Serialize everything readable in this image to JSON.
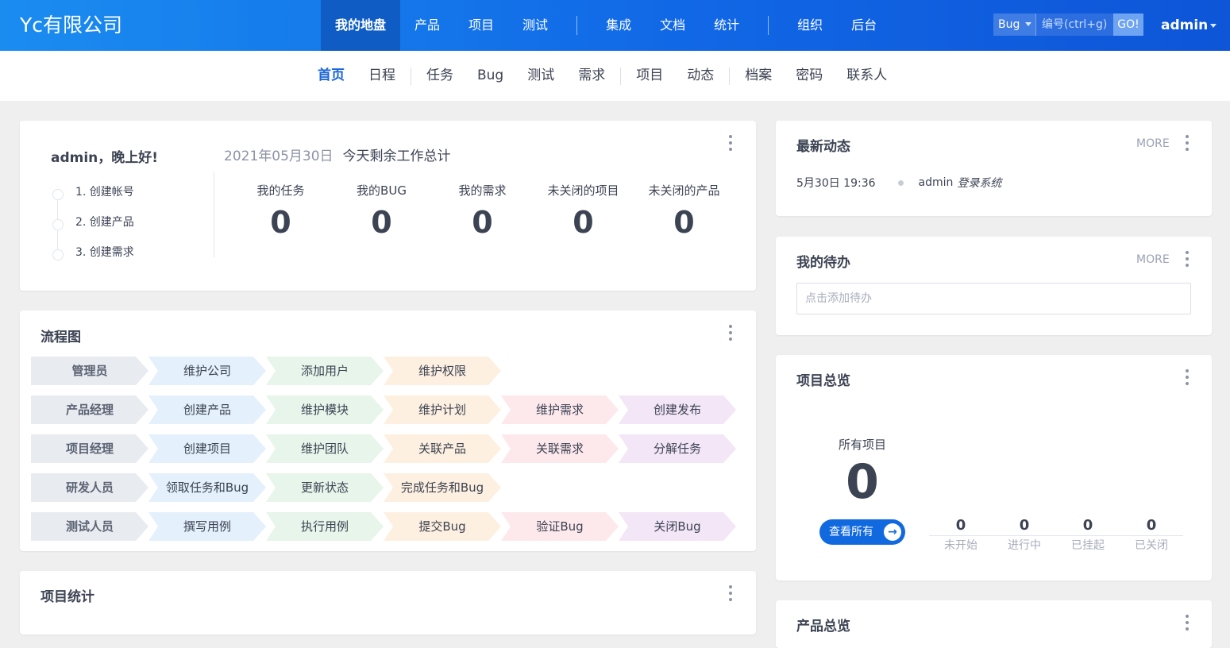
{
  "header": {
    "brand": "Yc有限公司",
    "nav": [
      {
        "label": "我的地盘",
        "active": true
      },
      {
        "label": "产品"
      },
      {
        "label": "项目"
      },
      {
        "label": "测试"
      },
      {
        "label": "集成"
      },
      {
        "label": "文档"
      },
      {
        "label": "统计"
      },
      {
        "label": "组织"
      },
      {
        "label": "后台"
      }
    ],
    "search": {
      "type": "Bug",
      "placeholder": "编号(ctrl+g)",
      "go": "GO!"
    },
    "user": "admin"
  },
  "subnav": [
    {
      "label": "首页",
      "active": true
    },
    {
      "label": "日程"
    },
    {
      "label": "任务"
    },
    {
      "label": "Bug"
    },
    {
      "label": "测试"
    },
    {
      "label": "需求"
    },
    {
      "label": "项目"
    },
    {
      "label": "动态"
    },
    {
      "label": "档案"
    },
    {
      "label": "密码"
    },
    {
      "label": "联系人"
    }
  ],
  "welcome": {
    "greeting": "admin，晚上好!",
    "steps": [
      "1. 创建帐号",
      "2. 创建产品",
      "3. 创建需求"
    ],
    "date": "2021年05月30日",
    "summary": "今天剩余工作总计",
    "stats": [
      {
        "label": "我的任务",
        "value": "0"
      },
      {
        "label": "我的BUG",
        "value": "0"
      },
      {
        "label": "我的需求",
        "value": "0"
      },
      {
        "label": "未关闭的项目",
        "value": "0"
      },
      {
        "label": "未关闭的产品",
        "value": "0"
      }
    ]
  },
  "flow": {
    "title": "流程图",
    "rows": [
      {
        "role": "管理员",
        "steps": [
          "维护公司",
          "添加用户",
          "维护权限"
        ]
      },
      {
        "role": "产品经理",
        "steps": [
          "创建产品",
          "维护模块",
          "维护计划",
          "维护需求",
          "创建发布"
        ]
      },
      {
        "role": "项目经理",
        "steps": [
          "创建项目",
          "维护团队",
          "关联产品",
          "关联需求",
          "分解任务"
        ]
      },
      {
        "role": "研发人员",
        "steps": [
          "领取任务和Bug",
          "更新状态",
          "完成任务和Bug"
        ]
      },
      {
        "role": "测试人员",
        "steps": [
          "撰写用例",
          "执行用例",
          "提交Bug",
          "验证Bug",
          "关闭Bug"
        ]
      }
    ]
  },
  "project_stats": {
    "title": "项目统计"
  },
  "dynamics": {
    "title": "最新动态",
    "more": "MORE",
    "items": [
      {
        "time": "5月30日 19:36",
        "who": "admin",
        "action": "登录系统"
      }
    ]
  },
  "todo": {
    "title": "我的待办",
    "more": "MORE",
    "placeholder": "点击添加待办"
  },
  "overview": {
    "title": "项目总览",
    "all_label": "所有项目",
    "all_value": "0",
    "view_all": "查看所有",
    "stats": [
      {
        "label": "未开始",
        "value": "0"
      },
      {
        "label": "进行中",
        "value": "0"
      },
      {
        "label": "已挂起",
        "value": "0"
      },
      {
        "label": "已关闭",
        "value": "0"
      }
    ]
  },
  "product_overview": {
    "title": "产品总览"
  }
}
